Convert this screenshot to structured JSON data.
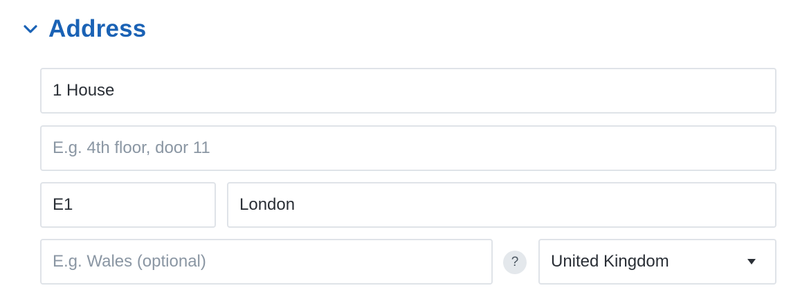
{
  "section": {
    "title": "Address",
    "expanded": true,
    "title_color": "#1a62b5",
    "chevron_icon": "chevron-down-icon"
  },
  "fields": {
    "address_line1": {
      "value": "1 House",
      "placeholder": ""
    },
    "address_line2": {
      "value": "",
      "placeholder": "E.g. 4th floor, door 11"
    },
    "postcode": {
      "value": "E1",
      "placeholder": ""
    },
    "city": {
      "value": "London",
      "placeholder": ""
    },
    "region": {
      "value": "",
      "placeholder": "E.g. Wales (optional)"
    },
    "country": {
      "selected": "United Kingdom",
      "caret_icon": "caret-down-icon"
    }
  },
  "help": {
    "label": "?",
    "icon": "help-icon"
  },
  "colors": {
    "border": "#dfe3e8",
    "text": "#2a2f36",
    "placeholder": "#8a96a3",
    "help_bg": "#e4e8ec"
  }
}
